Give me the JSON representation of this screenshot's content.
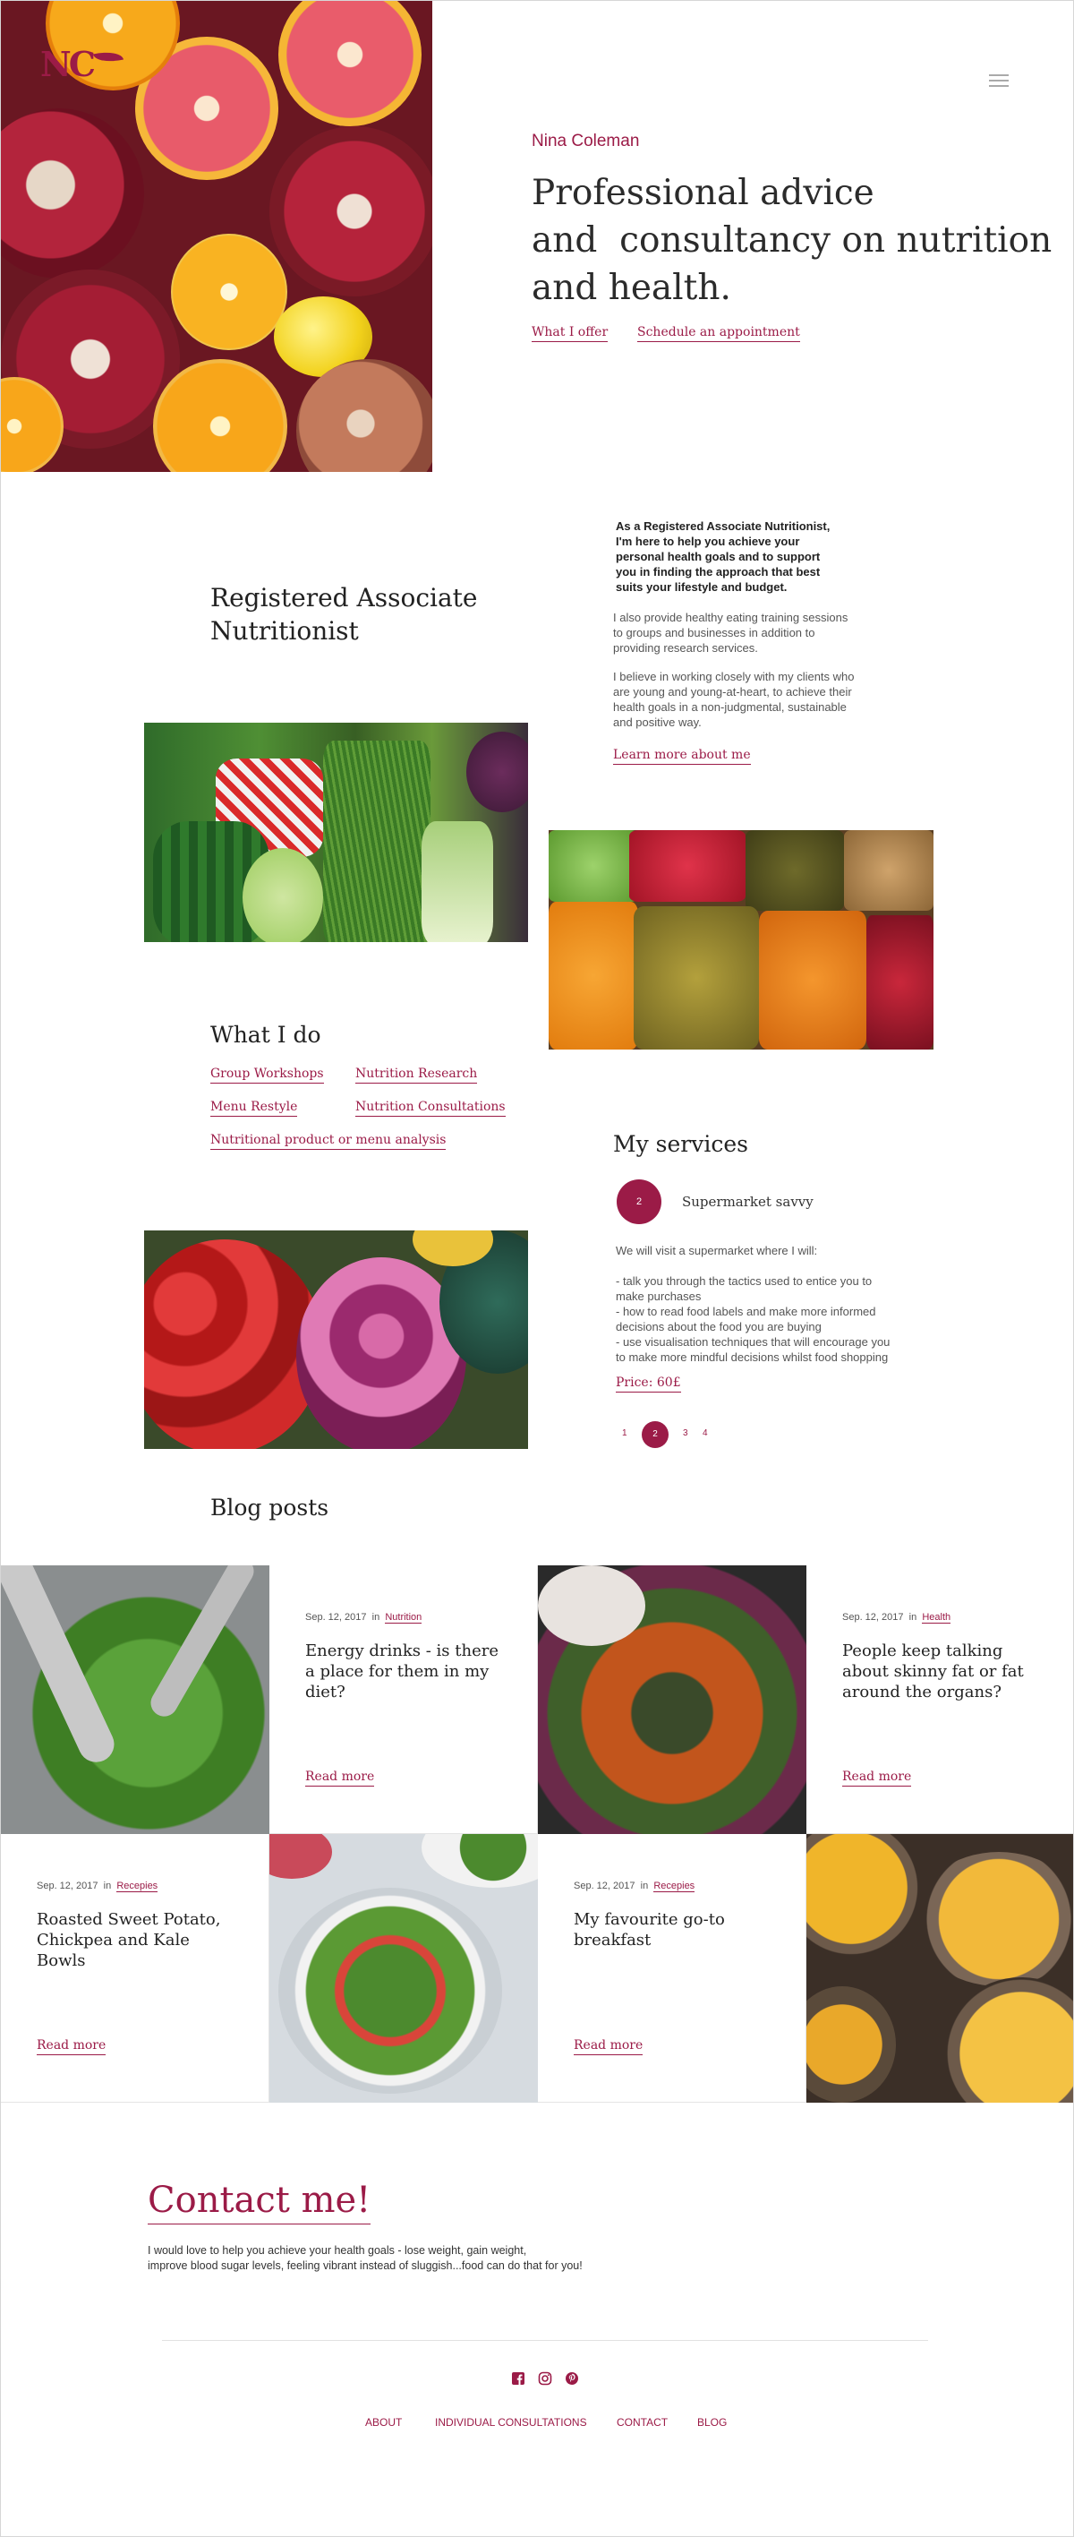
{
  "brand": {
    "logo_text": "NC",
    "accent_color": "#9b1b47"
  },
  "header": {
    "name": "Nina Coleman",
    "headline_lines": [
      "Professional advice",
      "and  consultancy on nutrition",
      "and health."
    ],
    "links": [
      "What I offer",
      "Schedule an appointment"
    ],
    "menu_icon": "hamburger-icon"
  },
  "about": {
    "title_lines": [
      "Registered Associate",
      "Nutritionist"
    ],
    "intro_lines": [
      "As a Registered Associate Nutritionist,",
      "I'm here to help you achieve your",
      "personal health goals and to support",
      "you in finding the approach that best",
      "suits your lifestyle and budget."
    ],
    "paragraph1_lines": [
      "I also provide healthy eating training sessions",
      "to groups and businesses in addition to",
      "providing research services."
    ],
    "paragraph2_lines": [
      "I believe in working closely with my clients who",
      "are young and young-at-heart, to achieve their",
      "health goals in a non-judgmental, sustainable",
      "and positive way."
    ],
    "learn_more": "Learn more about me"
  },
  "what_i_do": {
    "title": "What I do",
    "items": [
      "Group Workshops",
      "Nutrition Research",
      "Menu Restyle",
      "Nutrition Consultations",
      "Nutritional product or menu analysis"
    ]
  },
  "services": {
    "title": "My services",
    "current_number": "2",
    "service_name": "Supermarket savvy",
    "description_lines": [
      "We will visit a supermarket where I will:",
      "",
      "- talk you through the tactics used to entice you to",
      "make purchases",
      "- how to read food labels and make more informed",
      "decisions about the food you are buying",
      "- use visualisation techniques that will encourage you",
      "to make more mindful decisions whilst food shopping"
    ],
    "price": "Price: 60£",
    "pagination": [
      "1",
      "2",
      "3",
      "4"
    ],
    "active_page": "2"
  },
  "blog": {
    "title": "Blog posts",
    "in_word": "in",
    "read_more": "Read more",
    "posts": [
      {
        "date": "Sep. 12, 2017",
        "tag": "Nutrition",
        "title": "Energy drinks - is there a place for them in my diet?"
      },
      {
        "date": "Sep. 12, 2017",
        "tag": "Health",
        "title": "People keep talking about skinny fat or fat around the organs?"
      },
      {
        "date": "Sep. 12, 2017",
        "tag": "Recepies",
        "title": "Roasted Sweet Potato, Chickpea and Kale Bowls"
      },
      {
        "date": "Sep. 12, 2017",
        "tag": "Recepies",
        "title": "My favourite go-to breakfast"
      }
    ]
  },
  "contact": {
    "title": "Contact me!",
    "text_lines": [
      "I would love to help you achieve your health goals - lose weight, gain weight,",
      "improve blood sugar levels, feeling vibrant instead of sluggish...food can do that for you!"
    ]
  },
  "footer": {
    "social_icons": [
      "facebook-icon",
      "instagram-icon",
      "pinterest-icon"
    ],
    "links": [
      "ABOUT",
      "INDIVIDUAL CONSULTATIONS",
      "CONTACT",
      "BLOG"
    ]
  }
}
